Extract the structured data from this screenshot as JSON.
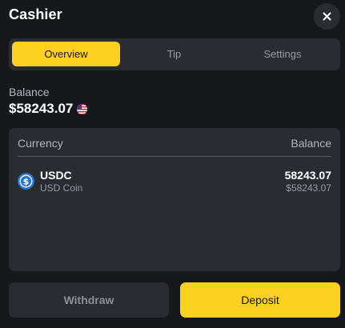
{
  "header": {
    "title": "Cashier",
    "close_icon": "close-icon"
  },
  "tabs": [
    {
      "label": "Overview",
      "active": true
    },
    {
      "label": "Tip",
      "active": false
    },
    {
      "label": "Settings",
      "active": false
    }
  ],
  "balance": {
    "label": "Balance",
    "amount": "$58243.07",
    "flag_icon": "us-flag-icon"
  },
  "currency_table": {
    "columns": [
      "Currency",
      "Balance"
    ],
    "rows": [
      {
        "icon": "usdc-coin-icon",
        "symbol": "USDC",
        "name": "USD Coin",
        "amount": "58243.07",
        "fiat_value": "$58243.07"
      }
    ]
  },
  "actions": {
    "withdraw_label": "Withdraw",
    "deposit_label": "Deposit"
  },
  "colors": {
    "background": "#17181c",
    "surface": "#2b2c31",
    "accent": "#fcd01f",
    "usdc_blue": "#2775ca"
  }
}
